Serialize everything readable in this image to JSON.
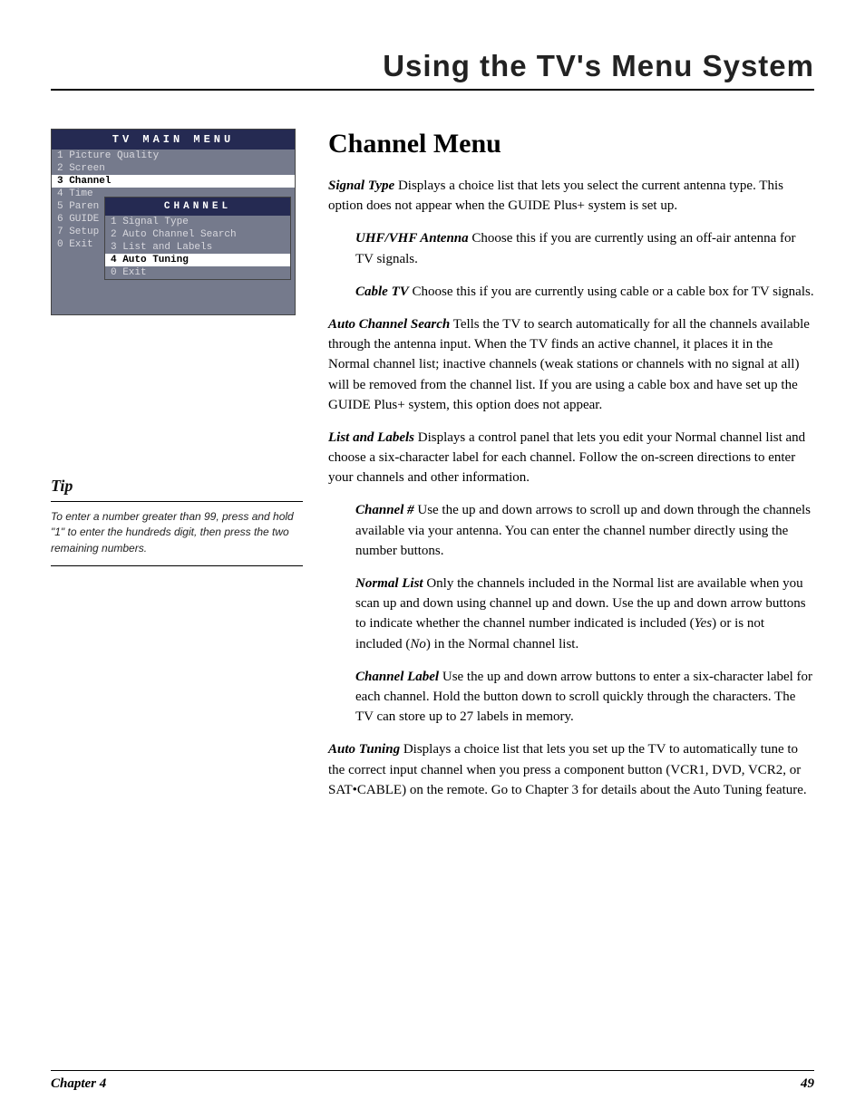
{
  "chapter_header": "Using the TV's Menu System",
  "menu": {
    "title": "TV MAIN MENU",
    "items": [
      "1 Picture Quality",
      "2 Screen",
      "3 Channel",
      "4 Time",
      "5 Paren",
      "6 GUIDE",
      "7 Setup",
      "0 Exit"
    ],
    "selected_index": 2
  },
  "submenu": {
    "title": "CHANNEL",
    "items": [
      "1 Signal Type",
      "2 Auto Channel Search",
      "3 List and Labels",
      "4 Auto Tuning",
      "0 Exit"
    ],
    "selected_index": 3
  },
  "tip": {
    "title": "Tip",
    "text": "To enter a number greater than 99, press and hold \"1\" to enter the hundreds digit, then press the two remaining numbers."
  },
  "heading": "Channel Menu",
  "body": {
    "p1_term": "Signal Type",
    "p1_rest": "   Displays a choice list that lets you select the current antenna type. This option does not appear when the GUIDE Plus+ system is set up.",
    "p2_term": "UHF/VHF Antenna",
    "p2_rest": "   Choose this if you are currently using an off-air antenna for TV signals.",
    "p3_term": "Cable TV",
    "p3_rest": "   Choose this if you are currently using cable or a cable box for TV signals.",
    "p4_term": "Auto Channel Search",
    "p4_rest": "   Tells the TV to search automatically for all the channels available through the antenna input. When the TV finds an active channel, it places it in the Normal channel list; inactive channels (weak stations or channels with no signal at all) will be removed from the channel list. If you are using a cable box and have set up the GUIDE Plus+ system, this option does not appear.",
    "p5_term": "List and Labels",
    "p5_rest": "   Displays a control panel that lets you edit your Normal channel list and choose a six-character label for each channel. Follow the on-screen directions to enter your channels and other information.",
    "p6_term": "Channel #",
    "p6_rest": "   Use the up and down arrows to scroll up and down through the channels available via your antenna. You can enter the channel number directly using the number buttons.",
    "p7_term": "Normal List",
    "p7_rest_a": "   Only the channels included in the Normal list are available when you scan up and down using channel up and down. Use the up and down arrow buttons to indicate whether the channel number indicated is included (",
    "p7_yes": "Yes",
    "p7_rest_b": ") or is not included (",
    "p7_no": "No",
    "p7_rest_c": ") in the Normal channel list.",
    "p8_term": "Channel Label",
    "p8_rest": "   Use the up and down arrow buttons to enter a six-character label for each channel. Hold the button down to scroll quickly through the characters. The TV can store up to 27 labels in memory.",
    "p9_term": "Auto Tuning",
    "p9_rest": "   Displays a choice list that lets you set up the TV to automatically tune to the correct input channel when you press a component button (VCR1, DVD, VCR2, or SAT•CABLE) on the remote. Go to Chapter 3 for details about the Auto Tuning feature."
  },
  "footer": {
    "left": "Chapter 4",
    "right": "49"
  }
}
